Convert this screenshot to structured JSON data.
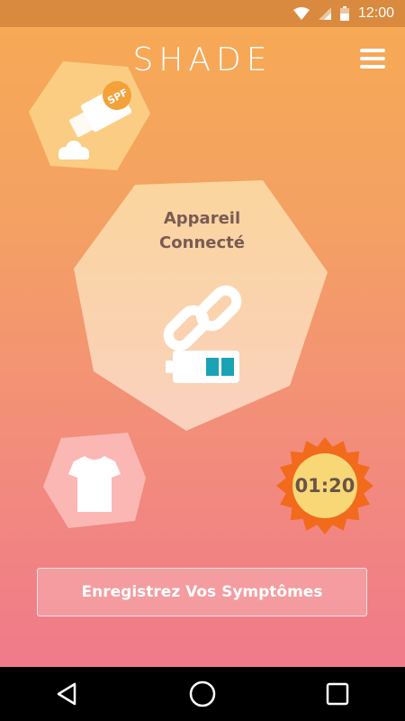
{
  "status_bar": {
    "time": "12:00",
    "icons": [
      "wifi-icon",
      "signal-icon",
      "battery-icon"
    ]
  },
  "header": {
    "logo": "SHADE",
    "menu_icon": "hamburger-menu-icon"
  },
  "spf_card": {
    "badge_text": "SPF",
    "icons": [
      "sunscreen-icon",
      "cloud-icon"
    ]
  },
  "device": {
    "title_line1": "Appareil",
    "title_line2": "Connecté",
    "link_icon": "link-icon",
    "battery_icon": "battery-icon",
    "battery_level": 0.5
  },
  "clothing": {
    "icon": "tshirt-icon"
  },
  "timer": {
    "value": "01:20",
    "icon": "sun-badge-icon"
  },
  "actions": {
    "symptoms_button": "Enregistrez Vos Symptômes"
  },
  "nav_bar": {
    "items": [
      "back-icon",
      "home-icon",
      "recents-icon"
    ]
  },
  "colors": {
    "status_bar": "#d98a3e",
    "gradient_top": "#f7a955",
    "gradient_bottom": "#f07a8a",
    "battery_fill": "#1aa3b4",
    "sun_outer": "#f26a1b",
    "sun_inner": "#f8d777",
    "title_text": "#7a5a53"
  }
}
